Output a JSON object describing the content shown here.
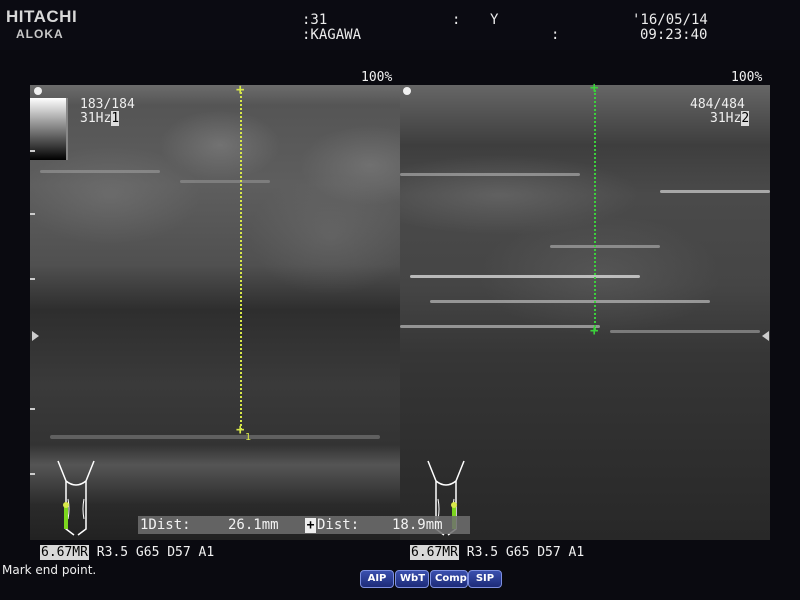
{
  "header": {
    "brand": "HITACHI",
    "brand_sub": "ALOKA",
    "id_value": ":31",
    "name_value": ":KAGAWA",
    "colon1": ":",
    "sex_value": "Y",
    "colon2": ":",
    "date": "'16/05/14",
    "time": "09:23:40"
  },
  "left_image": {
    "percent": "100%",
    "frame": "183/184",
    "rate": "31Hz",
    "frame_label": "1",
    "caliper_label": "1"
  },
  "right_image": {
    "percent": "100%",
    "frame": "484/484",
    "rate": "31Hz",
    "frame_label": "2"
  },
  "measurements": {
    "m1_label": "1Dist:",
    "m1_value": "26.1mm",
    "m2_label": "Dist:",
    "m2_value": "18.9mm"
  },
  "params": {
    "left_freq": "6.67MR",
    "left_rest": " R3.5 G65 D57 A1",
    "right_freq": "6.67MR",
    "right_rest": " R3.5 G65 D57 A1"
  },
  "status_text": "Mark end point.",
  "buttons": {
    "aip": "AIP",
    "wbt": "WbT",
    "comp": "Comp",
    "sip": "SIP"
  },
  "colors": {
    "caliper_left": "#d8e84a",
    "caliper_right": "#3bd13b",
    "button_bg": "#2a3c9a"
  }
}
